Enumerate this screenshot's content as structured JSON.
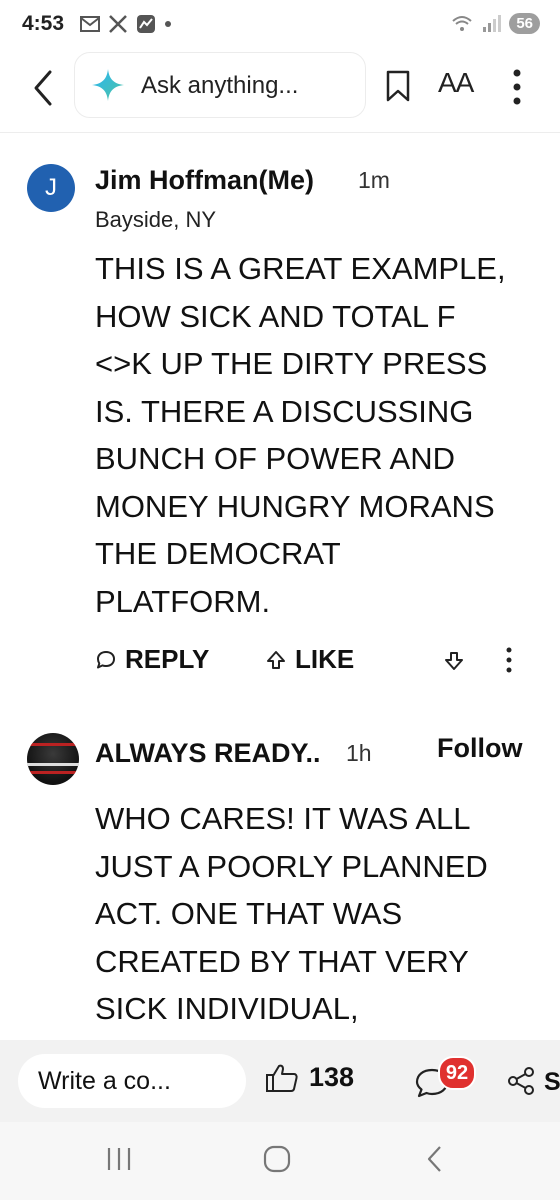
{
  "status_bar": {
    "time": "4:53",
    "battery": "56"
  },
  "top_bar": {
    "search_placeholder": "Ask anything...",
    "text_size_label": "AA"
  },
  "comments": [
    {
      "avatar_letter": "J",
      "author": "Jim Hoffman(Me)",
      "time": "1m",
      "location": "Bayside, NY",
      "lines": [
        "THIS IS A GREAT EXAMPLE,",
        "HOW SICK AND TOTAL F",
        "<>K UP THE DIRTY PRESS",
        "IS. THERE A DISCUSSING",
        "BUNCH OF POWER AND",
        "MONEY HUNGRY MORANS",
        "THE DEMOCRAT",
        "PLATFORM."
      ],
      "reply_label": "REPLY",
      "like_label": "LIKE"
    },
    {
      "author": "ALWAYS READY..",
      "time": "1h",
      "follow_label": "Follow",
      "lines": [
        "WHO CARES! IT WAS ALL",
        "JUST A POORLY PLANNED",
        "ACT. ONE THAT WAS",
        "CREATED BY THAT VERY",
        "SICK INDIVIDUAL,"
      ]
    }
  ],
  "comment_bar": {
    "write_placeholder": "Write a co...",
    "like_count": "138",
    "comment_count": "92",
    "share_label": "S"
  },
  "colors": {
    "avatar_blue": "#2161b0",
    "badge_red": "#e0312f"
  }
}
